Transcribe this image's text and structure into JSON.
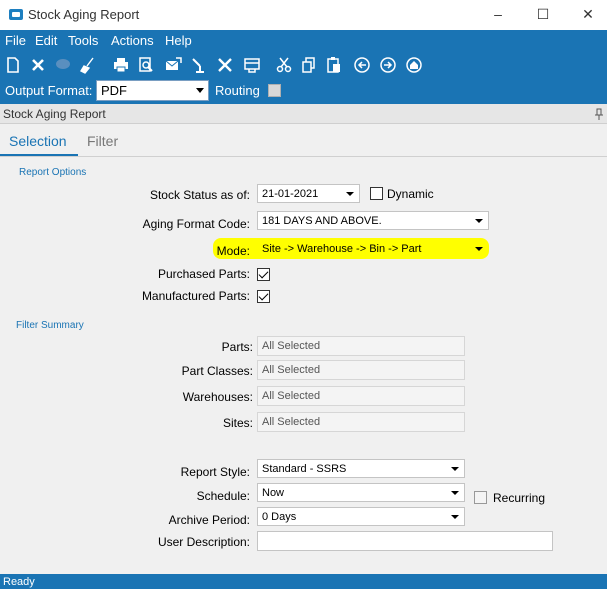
{
  "window": {
    "title": "Stock Aging Report"
  },
  "menu": [
    "File",
    "Edit",
    "Tools",
    "Actions",
    "Help"
  ],
  "toolbar_icons": [
    "new-icon",
    "delete-icon",
    "comment-icon",
    "clear-icon",
    "print-icon",
    "preview-icon",
    "email-icon",
    "export-icon",
    "tools-icon",
    "layout-icon",
    "cut-icon",
    "copy-icon",
    "paste-icon",
    "back-icon",
    "forward-icon",
    "home-icon"
  ],
  "format_bar": {
    "output_label": "Output Format:",
    "output_value": "PDF",
    "routing_label": "Routing"
  },
  "panel": {
    "title": "Stock Aging Report"
  },
  "tabs": {
    "selection": "Selection",
    "filter": "Filter"
  },
  "report_options": {
    "heading": "Report Options",
    "stock_status_label": "Stock Status as of:",
    "stock_status_value": "21-01-2021",
    "dynamic_label": "Dynamic",
    "aging_label": "Aging Format Code:",
    "aging_value": "181 DAYS AND ABOVE.",
    "mode_label": "Mode:",
    "mode_value": "Site -> Warehouse -> Bin -> Part",
    "purchased_label": "Purchased Parts:",
    "manufactured_label": "Manufactured Parts:"
  },
  "filter_summary": {
    "heading": "Filter Summary",
    "parts_label": "Parts:",
    "parts_value": "All Selected",
    "classes_label": "Part Classes:",
    "classes_value": "All Selected",
    "warehouses_label": "Warehouses:",
    "warehouses_value": "All Selected",
    "sites_label": "Sites:",
    "sites_value": "All Selected"
  },
  "output": {
    "style_label": "Report Style:",
    "style_value": "Standard - SSRS",
    "schedule_label": "Schedule:",
    "schedule_value": "Now",
    "recurring_label": "Recurring",
    "archive_label": "Archive Period:",
    "archive_value": "0 Days",
    "desc_label": "User Description:"
  },
  "status": {
    "text": "Ready"
  },
  "colors": {
    "accent": "#1a74b4",
    "highlight": "#ffff00"
  }
}
